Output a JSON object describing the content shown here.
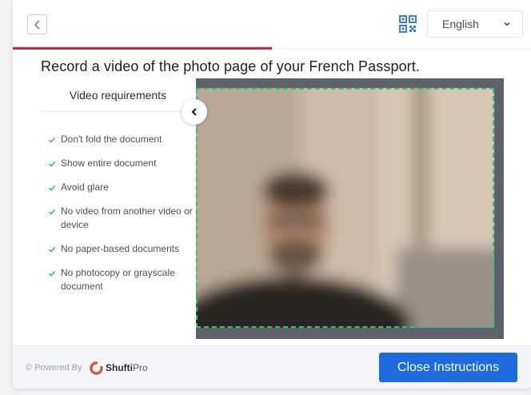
{
  "header": {
    "back_icon": "chevron-left-icon",
    "qr_icon": "qr-code-icon",
    "language": "English",
    "progress_fraction": 0.5,
    "progress_color": "#d0262f"
  },
  "main": {
    "title": "Record a video of the photo page of your French Passport."
  },
  "requirements": {
    "heading": "Video requirements",
    "check_color": "#2fb36b",
    "items": [
      "Don't fold the document",
      "Show entire document",
      "Avoid glare",
      "No video from another video or device",
      "No paper-based documents",
      "No photocopy or grayscale document"
    ]
  },
  "camera": {
    "frame_color": "#32c47f",
    "backdrop_color": "#5f626b"
  },
  "footer": {
    "powered_by": "© Powered By",
    "brand_bold": "Shufti",
    "brand_light": "Pro",
    "close_button": "Close Instructions",
    "button_color": "#1e6be0"
  }
}
